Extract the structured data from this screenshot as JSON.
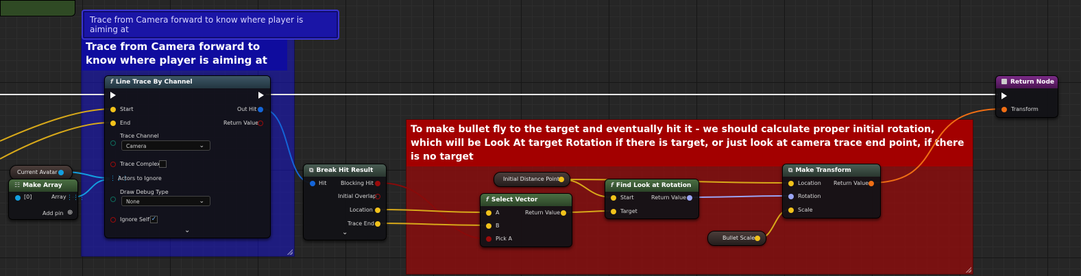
{
  "colors": {
    "blue_comment": "#10108f",
    "red_comment": "#8a0d0d",
    "exec_wire": "#ffffff",
    "vector_pin": "#f2c21b",
    "object_pin": "#139fe0",
    "struct_pin": "#1465d8",
    "bool_pin": "#9a0b0b",
    "rotator_pin": "#9aa5f5",
    "transform_pin": "#f06e14"
  },
  "bubble": {
    "text": "Trace from Camera forward to know where player is aiming at"
  },
  "comments": {
    "blue": {
      "text": "Trace from Camera forward to know where player is aiming at"
    },
    "red": {
      "text": "To make bullet fly to the target and eventually hit it - we should calculate proper initial rotation, which will be Look At target Rotation if there is target, or just look at camera trace end point, if there is no target"
    }
  },
  "nodes": {
    "current_avatar": {
      "label": "Current Avatar"
    },
    "make_array": {
      "title": "Make Array",
      "pin_in": "[0]",
      "pin_out": "Array",
      "add_pin": "Add pin"
    },
    "line_trace": {
      "title": "Line Trace By Channel",
      "start": "Start",
      "end": "End",
      "trace_channel": "Trace Channel",
      "trace_channel_value": "Camera",
      "trace_complex": "Trace Complex",
      "actors_to_ignore": "Actors to Ignore",
      "draw_debug_type": "Draw Debug Type",
      "draw_debug_value": "None",
      "ignore_self": "Ignore Self",
      "out_hit": "Out Hit",
      "return_value": "Return Value"
    },
    "break_hit": {
      "title": "Break Hit Result",
      "hit": "Hit",
      "blocking_hit": "Blocking Hit",
      "initial_overlap": "Initial Overlap",
      "location": "Location",
      "trace_end": "Trace End"
    },
    "initial_distance": {
      "label": "Initial Distance Point"
    },
    "select_vector": {
      "title": "Select Vector",
      "a": "A",
      "b": "B",
      "pick_a": "Pick A",
      "return_value": "Return Value"
    },
    "find_look": {
      "title": "Find Look at Rotation",
      "start": "Start",
      "target": "Target",
      "return_value": "Return Value"
    },
    "make_transform": {
      "title": "Make Transform",
      "location": "Location",
      "rotation": "Rotation",
      "scale": "Scale",
      "return_value": "Return Value"
    },
    "bullet_scale": {
      "label": "Bullet Scale"
    },
    "return_node": {
      "title": "Return Node",
      "transform": "Transform"
    }
  }
}
